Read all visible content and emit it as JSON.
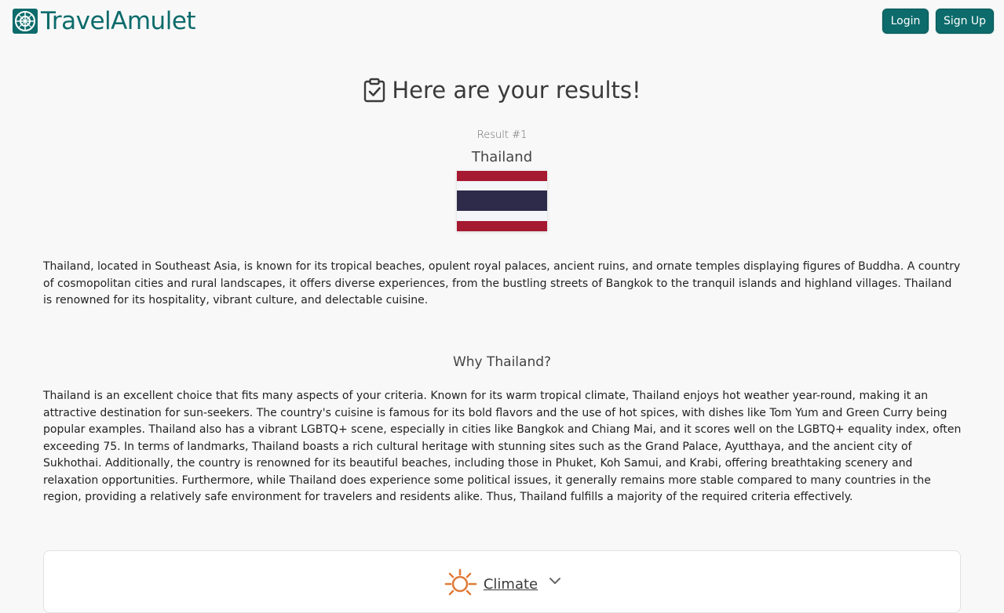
{
  "header": {
    "logo_text": "TravelAmulet",
    "login_label": "Login",
    "signup_label": "Sign Up"
  },
  "results": {
    "title": "Here are your results!",
    "result_number": "Result #1",
    "country": "Thailand",
    "description": "Thailand, located in Southeast Asia, is known for its tropical beaches, opulent royal palaces, ancient ruins, and ornate temples displaying figures of Buddha. A country of cosmopolitan cities and rural landscapes, it offers diverse experiences, from the bustling streets of Bangkok to the tranquil islands and highland villages. Thailand is renowned for its hospitality, vibrant culture, and delectable cuisine.",
    "why_heading": "Why Thailand?",
    "why_text": "Thailand is an excellent choice that fits many aspects of your criteria. Known for its warm tropical climate, Thailand enjoys hot weather year-round, making it an attractive destination for sun-seekers. The country's cuisine is famous for its bold flavors and the use of hot spices, with dishes like Tom Yum and Green Curry being popular examples. Thailand also has a vibrant LGBTQ+ scene, especially in cities like Bangkok and Chiang Mai, and it scores well on the LGBTQ+ equality index, often exceeding 75. In terms of landmarks, Thailand boasts a rich cultural heritage with stunning sites such as the Grand Palace, Ayutthaya, and the ancient city of Sukhothai. Additionally, the country is renowned for its beautiful beaches, including those in Phuket, Koh Samui, and Krabi, offering breathtaking scenery and relaxation opportunities. Furthermore, while Thailand does experience some political issues, it generally remains more stable compared to many countries in the region, providing a relatively safe environment for travelers and residents alike. Thus, Thailand fulfills a majority of the required criteria effectively."
  },
  "criteria": {
    "climate_label": "Climate"
  },
  "colors": {
    "brand": "#0d6b6b",
    "flag_red": "#a51931",
    "flag_white": "#f4f5f8",
    "flag_blue": "#2d2a4a",
    "climate_icon": "#e07b39"
  },
  "icons": [
    "logo-globe-icon",
    "clipboard-check-icon",
    "sun-icon",
    "chevron-down-icon"
  ]
}
